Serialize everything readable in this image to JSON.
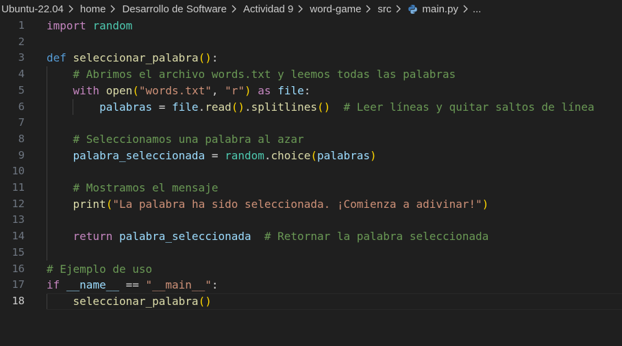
{
  "breadcrumb": {
    "items": [
      "Ubuntu-22.04",
      "home",
      "Desarrollo de Software",
      "Actividad 9",
      "word-game",
      "src"
    ],
    "file": "main.py",
    "trailing": "..."
  },
  "editor": {
    "language": "python",
    "active_line": 18,
    "line_numbers": [
      "1",
      "2",
      "3",
      "4",
      "5",
      "6",
      "7",
      "8",
      "9",
      "10",
      "11",
      "12",
      "13",
      "14",
      "15",
      "16",
      "17",
      "18"
    ],
    "lines": [
      [
        "import",
        " ",
        "random"
      ],
      [],
      [
        "def",
        " ",
        "seleccionar_palabra",
        "(",
        ")",
        ":"
      ],
      [
        "    ",
        "# Abrimos el archivo words.txt y leemos todas las palabras"
      ],
      [
        "    ",
        "with",
        " ",
        "open",
        "(",
        "\"words.txt\"",
        ", ",
        "\"r\"",
        ")",
        " ",
        "as",
        " ",
        "file",
        ":"
      ],
      [
        "        ",
        "palabras",
        " = ",
        "file",
        ".",
        "read",
        "(",
        ")",
        ".",
        "splitlines",
        "(",
        ")",
        "  ",
        "# Leer líneas y quitar saltos de línea"
      ],
      [],
      [
        "    ",
        "# Seleccionamos una palabra al azar"
      ],
      [
        "    ",
        "palabra_seleccionada",
        " = ",
        "random",
        ".",
        "choice",
        "(",
        "palabras",
        ")"
      ],
      [],
      [
        "    ",
        "# Mostramos el mensaje"
      ],
      [
        "    ",
        "print",
        "(",
        "\"La palabra ha sido seleccionada. ¡Comienza a adivinar!\"",
        ")"
      ],
      [],
      [
        "    ",
        "return",
        " ",
        "palabra_seleccionada",
        "  ",
        "# Retornar la palabra seleccionada"
      ],
      [],
      [
        "# Ejemplo de uso"
      ],
      [
        "if",
        " ",
        "__name__",
        " == ",
        "\"__main__\"",
        ":"
      ],
      [
        "    ",
        "seleccionar_palabra",
        "(",
        ")"
      ]
    ]
  },
  "colors": {
    "background": "#1f1f1f",
    "keyword_control": "#c586c0",
    "keyword": "#569cd6",
    "module": "#4ec9b0",
    "function": "#dcdcaa",
    "variable": "#9cdcfe",
    "string": "#ce9178",
    "comment": "#6a9955",
    "bracket_level1": "#ffd700",
    "bracket_level2": "#da70d6"
  },
  "icons": {
    "separator": "chevron-right-icon",
    "file": "python-icon"
  }
}
